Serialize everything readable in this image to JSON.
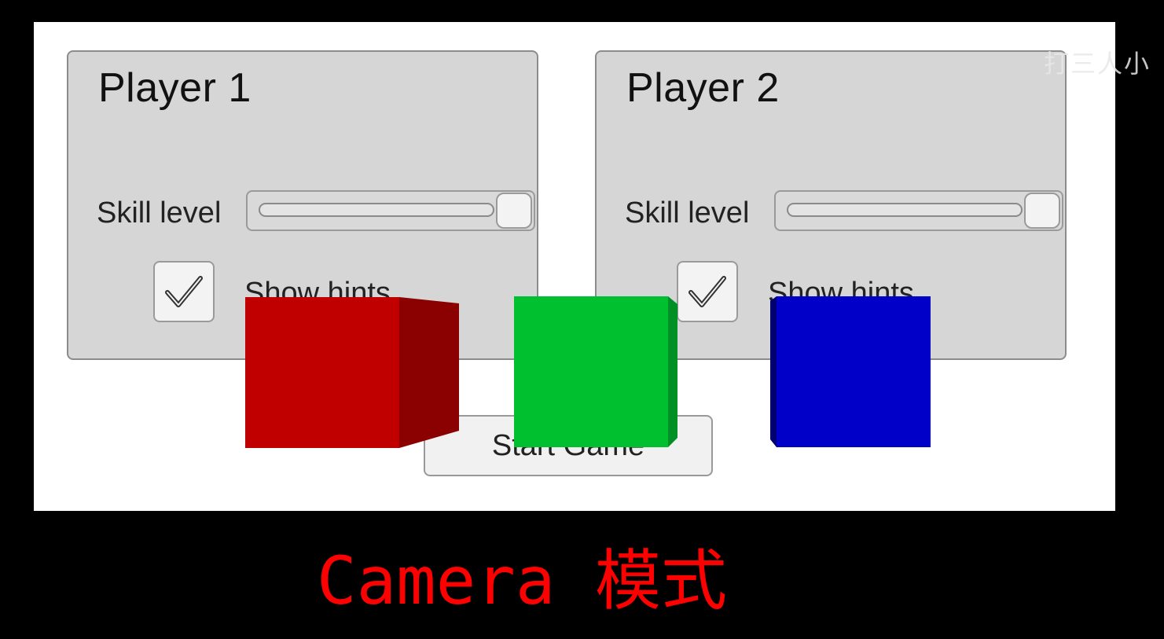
{
  "players": [
    {
      "title": "Player 1",
      "skill_label": "Skill level",
      "skill_level": 1.0,
      "hints_label": "Show hints",
      "hints_checked": true
    },
    {
      "title": "Player 2",
      "skill_label": "Skill level",
      "skill_level": 1.0,
      "hints_label": "Show hints",
      "hints_checked": true
    }
  ],
  "start_button": {
    "label": "Start Game"
  },
  "cubes": [
    {
      "name": "red-cube",
      "front": "#c00000",
      "side": "#8b0000"
    },
    {
      "name": "green-cube",
      "front": "#00c030",
      "side": "#009025"
    },
    {
      "name": "blue-cube",
      "front": "#0000c8",
      "side": "#000070"
    }
  ],
  "caption": {
    "text": "Camera 模式",
    "color": "#ff0000"
  },
  "watermark": {
    "text": "打三人小"
  }
}
